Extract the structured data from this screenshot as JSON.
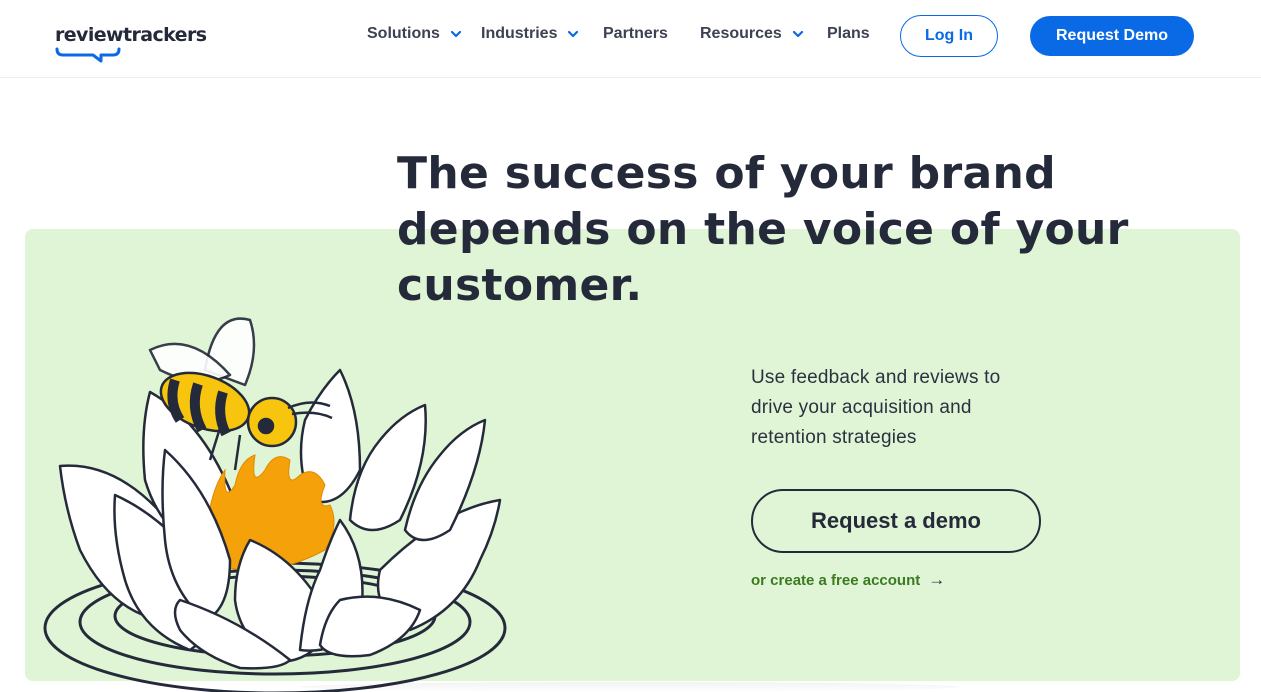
{
  "brand": {
    "name": "reviewtrackers"
  },
  "nav": {
    "items": [
      {
        "label": "Solutions",
        "has_dropdown": true
      },
      {
        "label": "Industries",
        "has_dropdown": true
      },
      {
        "label": "Partners",
        "has_dropdown": false
      },
      {
        "label": "Resources",
        "has_dropdown": true
      },
      {
        "label": "Plans",
        "has_dropdown": false
      }
    ],
    "login_label": "Log In",
    "request_demo_label": "Request Demo"
  },
  "hero": {
    "headline_lines": [
      "The success of your brand",
      "depends on the voice of your",
      "customer."
    ],
    "subtext_lines": [
      "Use feedback and reviews to",
      "drive your acquisition and",
      "retention strategies"
    ],
    "cta_label": "Request a demo",
    "secondary_link_label": "or create a free account",
    "secondary_link_arrow": "→"
  },
  "colors": {
    "brand_blue": "#0a6ae6",
    "hero_green": "#dff5d6",
    "link_green": "#3c7a22",
    "ink": "#252a3a",
    "bee_yellow": "#f7c50e",
    "flame_orange": "#f5a10a"
  },
  "icons": {
    "dropdown": "chevron-down-icon",
    "arrow": "arrow-right-icon"
  }
}
